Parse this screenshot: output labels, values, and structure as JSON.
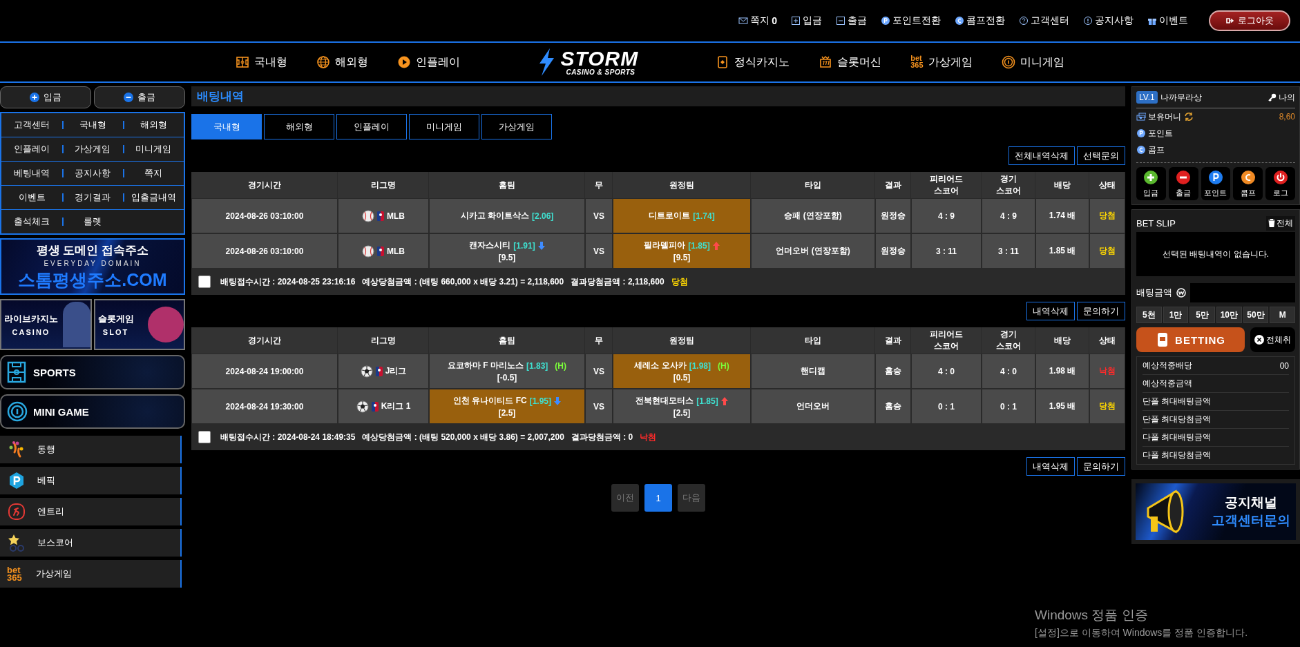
{
  "top_links": [
    {
      "label": "쪽지",
      "count": "0"
    },
    {
      "label": "입금"
    },
    {
      "label": "출금"
    },
    {
      "label": "포인트전환"
    },
    {
      "label": "콤프전환"
    },
    {
      "label": "고객센터"
    },
    {
      "label": "공지사항"
    },
    {
      "label": "이벤트"
    }
  ],
  "logout_button": "로그아웃",
  "main_nav": {
    "left": [
      {
        "label": "국내형"
      },
      {
        "label": "해외형"
      },
      {
        "label": "인플레이"
      }
    ],
    "logo": {
      "title": "STORM",
      "subtitle": "CASINO & SPORTS"
    },
    "right": [
      {
        "label": "정식카지노"
      },
      {
        "label": "슬롯머신"
      },
      {
        "label": "가상게임",
        "badge": [
          "bet",
          "365"
        ]
      },
      {
        "label": "미니게임"
      }
    ]
  },
  "sidebar": {
    "deposit_button": "입금",
    "withdraw_button": "출금",
    "menu": [
      "고객센터",
      "국내형",
      "해외형",
      "인플레이",
      "가상게임",
      "미니게임",
      "베팅내역",
      "공지사항",
      "쪽지",
      "이벤트",
      "경기결과",
      "입출금내역",
      "출석체크",
      "룰렛"
    ],
    "domain_banner": {
      "title": "평생 도메인 접속주소",
      "subtitle": "EVERYDAY DOMAIN",
      "address": "스톰평생주소.COM"
    },
    "game_banners": [
      {
        "title": "라이브카지노",
        "subtitle": "CASINO"
      },
      {
        "title": "슬롯게임",
        "subtitle": "SLOT"
      }
    ],
    "category_buttons": [
      "SPORTS",
      "MINI GAME"
    ],
    "providers": [
      {
        "label": "동행"
      },
      {
        "label": "베픽"
      },
      {
        "label": "엔트리"
      },
      {
        "label": "보스코어"
      },
      {
        "label": "가상게임",
        "badge": [
          "bet",
          "365"
        ]
      }
    ]
  },
  "bet_history": {
    "title": "배팅내역",
    "tabs": [
      {
        "label": "국내형",
        "selected": true
      },
      {
        "label": "해외형",
        "selected": false
      },
      {
        "label": "인플레이",
        "selected": false
      },
      {
        "label": "미니게임",
        "selected": false
      },
      {
        "label": "가상게임",
        "selected": false
      }
    ],
    "top_actions": [
      "전체내역삭제",
      "선택문의"
    ],
    "bets": [
      {
        "columns": [
          "경기시간",
          "리그명",
          "홈팀",
          "무",
          "원정팀",
          "타입",
          "결과",
          "피리어드 스코어",
          "경기 스코어",
          "배당",
          "상태"
        ],
        "rows": [
          {
            "time": "2024-08-26 03:10:00",
            "league": {
              "name": "MLB",
              "kind": "baseball"
            },
            "home": {
              "team": "시카고 화이트삭스",
              "odds": "[2.06]",
              "picked": false
            },
            "draw": "VS",
            "away": {
              "team": "디트로이트",
              "odds": "[1.74]",
              "picked": true
            },
            "type": "승패 (연장포함)",
            "result": "원정승",
            "period_score": "4 : 9",
            "game_score": "4 : 9",
            "odds": "1.74 배",
            "status": {
              "text": "당첨",
              "won": true
            }
          },
          {
            "time": "2024-08-26 03:10:00",
            "league": {
              "name": "MLB",
              "kind": "baseball"
            },
            "home": {
              "team": "캔자스시티",
              "odds": "[1.91]",
              "odds_down": true,
              "line": "[9.5]",
              "picked": false
            },
            "draw": "VS",
            "away": {
              "team": "필라델피아",
              "odds": "[1.85]",
              "odds_up": true,
              "line": "[9.5]",
              "picked": true
            },
            "type": "언더오버 (연장포함)",
            "result": "원정승",
            "period_score": "3 : 11",
            "game_score": "3 : 11",
            "odds": "1.85 배",
            "status": {
              "text": "당첨",
              "won": true
            }
          }
        ],
        "summary": {
          "checked": false,
          "time": "배팅접수시간 : 2024-08-25 23:16:16",
          "expected": "예상당첨금액 : (배팅 660,000 x 배당 3.21) = 2,118,600",
          "payout": "결과당첨금액 : 2,118,600",
          "status": {
            "text": "당첨",
            "won": true
          }
        },
        "actions": [
          "내역삭제",
          "문의하기"
        ]
      },
      {
        "columns": [
          "경기시간",
          "리그명",
          "홈팀",
          "무",
          "원정팀",
          "타입",
          "결과",
          "피리어드 스코어",
          "경기 스코어",
          "배당",
          "상태"
        ],
        "rows": [
          {
            "time": "2024-08-24 19:00:00",
            "league": {
              "name": "J리그",
              "kind": "soccer"
            },
            "home": {
              "team": "요코하마 F 마리노스",
              "odds": "[1.83]",
              "tag": "(H)",
              "line": "[-0.5]",
              "picked": false
            },
            "draw": "VS",
            "away": {
              "team": "세레소 오사카",
              "odds": "[1.98]",
              "tag": "(H)",
              "line": "[0.5]",
              "picked": true
            },
            "type": "핸디캡",
            "result": "홈승",
            "period_score": "4 : 0",
            "game_score": "4 : 0",
            "odds": "1.98 배",
            "status": {
              "text": "낙첨",
              "won": false
            }
          },
          {
            "time": "2024-08-24 19:30:00",
            "league": {
              "name": "K리그 1",
              "kind": "soccer"
            },
            "home": {
              "team": "인천 유나이티드 FC",
              "odds": "[1.95]",
              "odds_down": true,
              "line": "[2.5]",
              "picked": true
            },
            "draw": "VS",
            "away": {
              "team": "전북현대모터스",
              "odds": "[1.85]",
              "odds_up": true,
              "line": "[2.5]",
              "picked": false
            },
            "type": "언더오버",
            "result": "홈승",
            "period_score": "0 : 1",
            "game_score": "0 : 1",
            "odds": "1.95 배",
            "status": {
              "text": "당첨",
              "won": true
            }
          }
        ],
        "summary": {
          "checked": false,
          "time": "배팅접수시간 : 2024-08-24 18:49:35",
          "expected": "예상당첨금액 : (배팅 520,000 x 배당 3.86) = 2,007,200",
          "payout": "결과당첨금액 : 0",
          "status": {
            "text": "낙첨",
            "won": false
          }
        },
        "actions": [
          "내역삭제",
          "문의하기"
        ]
      }
    ],
    "pagination": {
      "prev": "이전",
      "pages": [
        {
          "label": "1",
          "selected": true
        }
      ],
      "next": "다음"
    }
  },
  "right_panel": {
    "user": {
      "level": "LV.1",
      "name": "나까무라상",
      "my_page": "나의"
    },
    "wallet": [
      {
        "label": "보유머니",
        "value": "8,60",
        "kind": "money"
      },
      {
        "label": "포인트",
        "kind": "point"
      },
      {
        "label": "콤프",
        "kind": "comp"
      }
    ],
    "quick_actions": [
      "입금",
      "출금",
      "포인트",
      "콤프",
      "로그"
    ],
    "bet_slip": {
      "title": "BET SLIP",
      "clear_button": "전체",
      "empty_text": "선택된 배팅내역이 없습니다.",
      "amount_label": "배팅금액",
      "chips": [
        "5천",
        "1만",
        "5만",
        "10만",
        "50만",
        "M"
      ],
      "bet_button": "BETTING",
      "cancel_button": "전체취",
      "stats": [
        {
          "label": "예상적중배당",
          "value": "00"
        },
        {
          "label": "예상적중금액"
        },
        {
          "label": "단폴 최대배팅금액"
        },
        {
          "label": "단폴 최대당첨금액"
        },
        {
          "label": "다폴 최대배팅금액"
        },
        {
          "label": "다폴 최대당첨금액"
        }
      ]
    },
    "notice_banner": {
      "title": "공지채널",
      "subtitle": "고객센터문의"
    }
  },
  "os_notice": {
    "title": "Windows 정품 인증",
    "text": "[설정]으로 이동하여 Windows를 정품 인증합니다."
  }
}
